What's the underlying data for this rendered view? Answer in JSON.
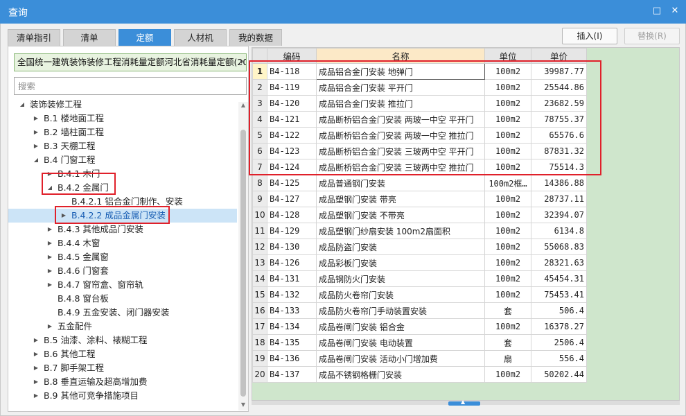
{
  "window": {
    "title": "查询",
    "max_glyph": "□",
    "close_glyph": "✕"
  },
  "tabs": [
    "清单指引",
    "清单",
    "定额",
    "人材机",
    "我的数据"
  ],
  "buttons": {
    "insert": "插入(I)",
    "replace": "替换(R)"
  },
  "library": {
    "selected": "全国统一建筑装饰装修工程消耗量定额河北省消耗量定额(20",
    "arrow": "▾"
  },
  "search": {
    "placeholder": "搜索"
  },
  "tree": [
    {
      "label": "装饰装修工程",
      "toggle": "◢",
      "level": 0
    },
    {
      "label": "B.1 楼地面工程",
      "toggle": "▶",
      "level": 1
    },
    {
      "label": "B.2 墙柱面工程",
      "toggle": "▶",
      "level": 1
    },
    {
      "label": "B.3 天棚工程",
      "toggle": "▶",
      "level": 1
    },
    {
      "label": "B.4 门窗工程",
      "toggle": "◢",
      "level": 1
    },
    {
      "label": "B.4.1 木门",
      "toggle": "▶",
      "level": 2
    },
    {
      "label": "B.4.2 金属门",
      "toggle": "◢",
      "level": 2
    },
    {
      "label": "B.4.2.1 铝合金门制作、安装",
      "toggle": "",
      "level": 3
    },
    {
      "label": "B.4.2.2 成品金属门安装",
      "toggle": "▶",
      "level": 3,
      "selected": true
    },
    {
      "label": "B.4.3 其他成品门安装",
      "toggle": "▶",
      "level": 2
    },
    {
      "label": "B.4.4 木窗",
      "toggle": "▶",
      "level": 2
    },
    {
      "label": "B.4.5 金属窗",
      "toggle": "▶",
      "level": 2
    },
    {
      "label": "B.4.6 门窗套",
      "toggle": "▶",
      "level": 2
    },
    {
      "label": "B.4.7 窗帘盒、窗帘轨",
      "toggle": "▶",
      "level": 2
    },
    {
      "label": "B.4.8 窗台板",
      "toggle": "",
      "level": 2
    },
    {
      "label": "B.4.9 五金安装、闭门器安装",
      "toggle": "",
      "level": 2
    },
    {
      "label": "五金配件",
      "toggle": "▶",
      "level": 2
    },
    {
      "label": "B.5 油漆、涂料、裱糊工程",
      "toggle": "▶",
      "level": 1
    },
    {
      "label": "B.6 其他工程",
      "toggle": "▶",
      "level": 1
    },
    {
      "label": "B.7 脚手架工程",
      "toggle": "▶",
      "level": 1
    },
    {
      "label": "B.8 垂直运输及超高增加费",
      "toggle": "▶",
      "level": 1
    },
    {
      "label": "B.9 其他可竞争措施项目",
      "toggle": "▶",
      "level": 1
    }
  ],
  "grid": {
    "headers": [
      "",
      "编码",
      "名称",
      "单位",
      "单价"
    ],
    "rows": [
      [
        "1",
        "B4-118",
        "成品铝合金门安装 地弹门",
        "100m2",
        "39987.77"
      ],
      [
        "2",
        "B4-119",
        "成品铝合金门安装 平开门",
        "100m2",
        "25544.86"
      ],
      [
        "3",
        "B4-120",
        "成品铝合金门安装 推拉门",
        "100m2",
        "23682.59"
      ],
      [
        "4",
        "B4-121",
        "成品断桥铝合金门安装 两玻一中空 平开门",
        "100m2",
        "78755.37"
      ],
      [
        "5",
        "B4-122",
        "成品断桥铝合金门安装 两玻一中空 推拉门",
        "100m2",
        "65576.6"
      ],
      [
        "6",
        "B4-123",
        "成品断桥铝合金门安装 三玻两中空 平开门",
        "100m2",
        "87831.32"
      ],
      [
        "7",
        "B4-124",
        "成品断桥铝合金门安装 三玻两中空 推拉门",
        "100m2",
        "75514.3"
      ],
      [
        "8",
        "B4-125",
        "成品普通钢门安装",
        "100m2框…",
        "14386.88"
      ],
      [
        "9",
        "B4-127",
        "成品塑钢门安装 带亮",
        "100m2",
        "28737.11"
      ],
      [
        "10",
        "B4-128",
        "成品塑钢门安装 不带亮",
        "100m2",
        "32394.07"
      ],
      [
        "11",
        "B4-129",
        "成品塑钢门纱扇安装 100m2扇面积",
        "100m2",
        "6134.8"
      ],
      [
        "12",
        "B4-130",
        "成品防盗门安装",
        "100m2",
        "55068.83"
      ],
      [
        "13",
        "B4-126",
        "成品彩板门安装",
        "100m2",
        "28321.63"
      ],
      [
        "14",
        "B4-131",
        "成品钢防火门安装",
        "100m2",
        "45454.31"
      ],
      [
        "15",
        "B4-132",
        "成品防火卷帘门安装",
        "100m2",
        "75453.41"
      ],
      [
        "16",
        "B4-133",
        "成品防火卷帘门手动装置安装",
        "套",
        "506.4"
      ],
      [
        "17",
        "B4-134",
        "成品卷闸门安装 铝合金",
        "100m2",
        "16378.27"
      ],
      [
        "18",
        "B4-135",
        "成品卷闸门安装 电动装置",
        "套",
        "2506.4"
      ],
      [
        "19",
        "B4-136",
        "成品卷闸门安装 活动小门增加费",
        "扇",
        "556.4"
      ],
      [
        "20",
        "B4-137",
        "成品不锈钢格栅门安装",
        "100m2",
        "50202.44"
      ]
    ]
  },
  "splitter": {
    "glyph": "▲"
  }
}
